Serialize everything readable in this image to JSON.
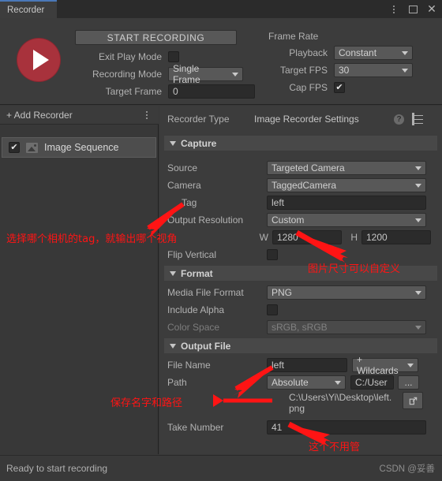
{
  "window": {
    "tab_label": "Recorder",
    "icons": {
      "menu": "kebab-menu-icon",
      "maximize": "maximize-icon",
      "close": "close-icon"
    }
  },
  "header": {
    "record_button": "record-button",
    "start_recording_label": "START RECORDING",
    "exit_play_mode_label": "Exit Play Mode",
    "exit_play_mode_checked": false,
    "recording_mode_label": "Recording Mode",
    "recording_mode_value": "Single Frame",
    "target_frame_label": "Target Frame",
    "target_frame_value": "0",
    "frame_rate_title": "Frame Rate",
    "playback_label": "Playback",
    "playback_value": "Constant",
    "target_fps_label": "Target FPS",
    "target_fps_value": "30",
    "cap_fps_label": "Cap FPS",
    "cap_fps_checked": true,
    "check_glyph": "✔"
  },
  "sidebar": {
    "add_recorder_label": "+ Add Recorder",
    "items": [
      {
        "label": "Image Sequence",
        "checked": true,
        "icon": "image-icon"
      }
    ]
  },
  "settings": {
    "recorder_type_label": "Recorder Type",
    "recorder_type_value": "Image Recorder Settings",
    "capture": {
      "title": "Capture",
      "source_label": "Source",
      "source_value": "Targeted Camera",
      "camera_label": "Camera",
      "camera_value": "TaggedCamera",
      "tag_label": "Tag",
      "tag_value": "left",
      "output_resolution_label": "Output Resolution",
      "output_resolution_value": "Custom",
      "width_prefix": "W",
      "width_value": "1280",
      "height_prefix": "H",
      "height_value": "1200",
      "flip_vertical_label": "Flip Vertical",
      "flip_vertical_checked": false
    },
    "format": {
      "title": "Format",
      "media_file_format_label": "Media File Format",
      "media_file_format_value": "PNG",
      "include_alpha_label": "Include Alpha",
      "include_alpha_checked": false,
      "color_space_label": "Color Space",
      "color_space_value": "sRGB, sRGB"
    },
    "output_file": {
      "title": "Output File",
      "file_name_label": "File Name",
      "file_name_value": "left",
      "wildcards_label": "+ Wildcards",
      "path_label": "Path",
      "path_value": "Absolute",
      "path_field_value": "C:/User",
      "browse_label": "...",
      "resolved_path": "C:\\Users\\Yi\\Desktop\\left.png",
      "open_folder_icon": "external-link-icon",
      "take_number_label": "Take Number",
      "take_number_value": "41"
    }
  },
  "status": {
    "message": "Ready to start recording",
    "watermark": "CSDN @妥善"
  },
  "annotations": {
    "color": "#ff1414",
    "camera_tag_note": "选择哪个相机的tag，就输出哪个视角",
    "image_size_note": "图片尺寸可以自定义",
    "save_path_note": "保存名字和路径",
    "take_number_note": "这个不用管"
  }
}
